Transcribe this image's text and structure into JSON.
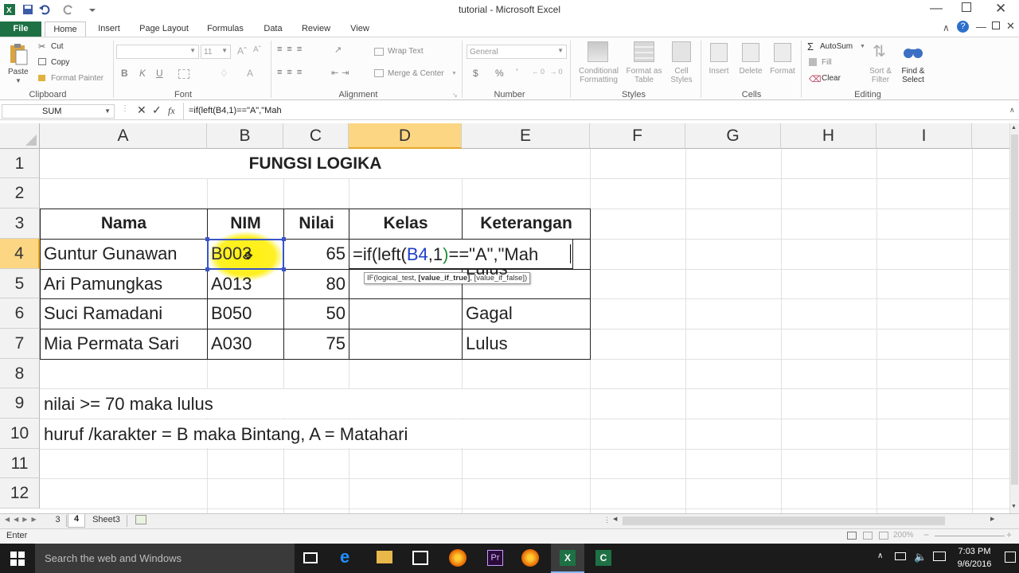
{
  "window": {
    "title": "tutorial  -  Microsoft Excel",
    "min_icon": "minimize-icon",
    "restore_icon": "restore-icon",
    "close_icon": "close-icon"
  },
  "tabs": [
    "File",
    "Home",
    "Insert",
    "Page Layout",
    "Formulas",
    "Data",
    "Review",
    "View"
  ],
  "ribbon": {
    "clipboard": {
      "paste": "Paste",
      "cut": "Cut",
      "copy": "Copy",
      "format_painter": "Format Painter",
      "group": "Clipboard"
    },
    "font": {
      "size": "11",
      "bold": "B",
      "italic": "K",
      "underline": "U",
      "group": "Font"
    },
    "alignment": {
      "wrap": "Wrap Text",
      "merge": "Merge & Center",
      "group": "Alignment"
    },
    "number": {
      "format": "General",
      "currency": "$",
      "percent": "%",
      "group": "Number"
    },
    "styles": {
      "conditional": "Conditional Formatting",
      "table": "Format as Table",
      "cell": "Cell Styles",
      "group": "Styles"
    },
    "cells": {
      "insert": "Insert",
      "delete": "Delete",
      "format": "Format",
      "group": "Cells"
    },
    "editing": {
      "autosum": "AutoSum",
      "fill": "Fill",
      "clear": "Clear",
      "sort": "Sort & Filter",
      "find": "Find & Select",
      "group": "Editing"
    }
  },
  "formula_bar": {
    "name_box": "SUM",
    "fx": "fx",
    "formula": "=if(left(B4,1)==\"A\",\"Mah"
  },
  "columns": [
    "A",
    "B",
    "C",
    "D",
    "E",
    "F",
    "G",
    "H",
    "I"
  ],
  "rows": [
    "1",
    "2",
    "3",
    "4",
    "5",
    "6",
    "7",
    "8",
    "9",
    "10",
    "11",
    "12"
  ],
  "sheet": {
    "title": "FUNGSI LOGIKA",
    "headers": {
      "nama": "Nama",
      "nim": "NIM",
      "nilai": "Nilai",
      "kelas": "Kelas",
      "keterangan": "Keterangan"
    },
    "data": [
      {
        "nama": "Guntur Gunawan",
        "nim": "B003",
        "nilai": "65",
        "kelas": "",
        "keterangan": ""
      },
      {
        "nama": "Ari Pamungkas",
        "nim": "A013",
        "nilai": "80",
        "kelas": "",
        "keterangan": "Lulus"
      },
      {
        "nama": "Suci Ramadani",
        "nim": "B050",
        "nilai": "50",
        "kelas": "",
        "keterangan": "Gagal"
      },
      {
        "nama": "Mia Permata Sari",
        "nim": "A030",
        "nilai": "75",
        "kelas": "",
        "keterangan": "Lulus"
      }
    ],
    "edit_parts": {
      "p1": "=if(left(",
      "ref": "B4",
      "p2": ",1",
      "paren": ")",
      "p3": "==\"A\",\"Mah"
    },
    "tooltip": {
      "a": "IF(logical_test, ",
      "b": "[value_if_true]",
      "c": ", [value_if_false])"
    },
    "note1": "nilai >= 70 maka lulus",
    "note2": "huruf /karakter = B maka Bintang, A = Matahari"
  },
  "sheet_tabs": [
    "3",
    "4",
    "Sheet3"
  ],
  "status": {
    "mode": "Enter",
    "zoom": "200%"
  },
  "taskbar": {
    "search": "Search the web and Windows",
    "time": "7:03 PM",
    "date": "9/6/2016"
  },
  "colors": {
    "excel_green": "#217346",
    "file_tab": "#1e7145",
    "selected_header": "#fcd682",
    "ref_blue": "#1f3ec7",
    "paren_green": "#1f8f3a",
    "highlight": "#ffee00"
  }
}
